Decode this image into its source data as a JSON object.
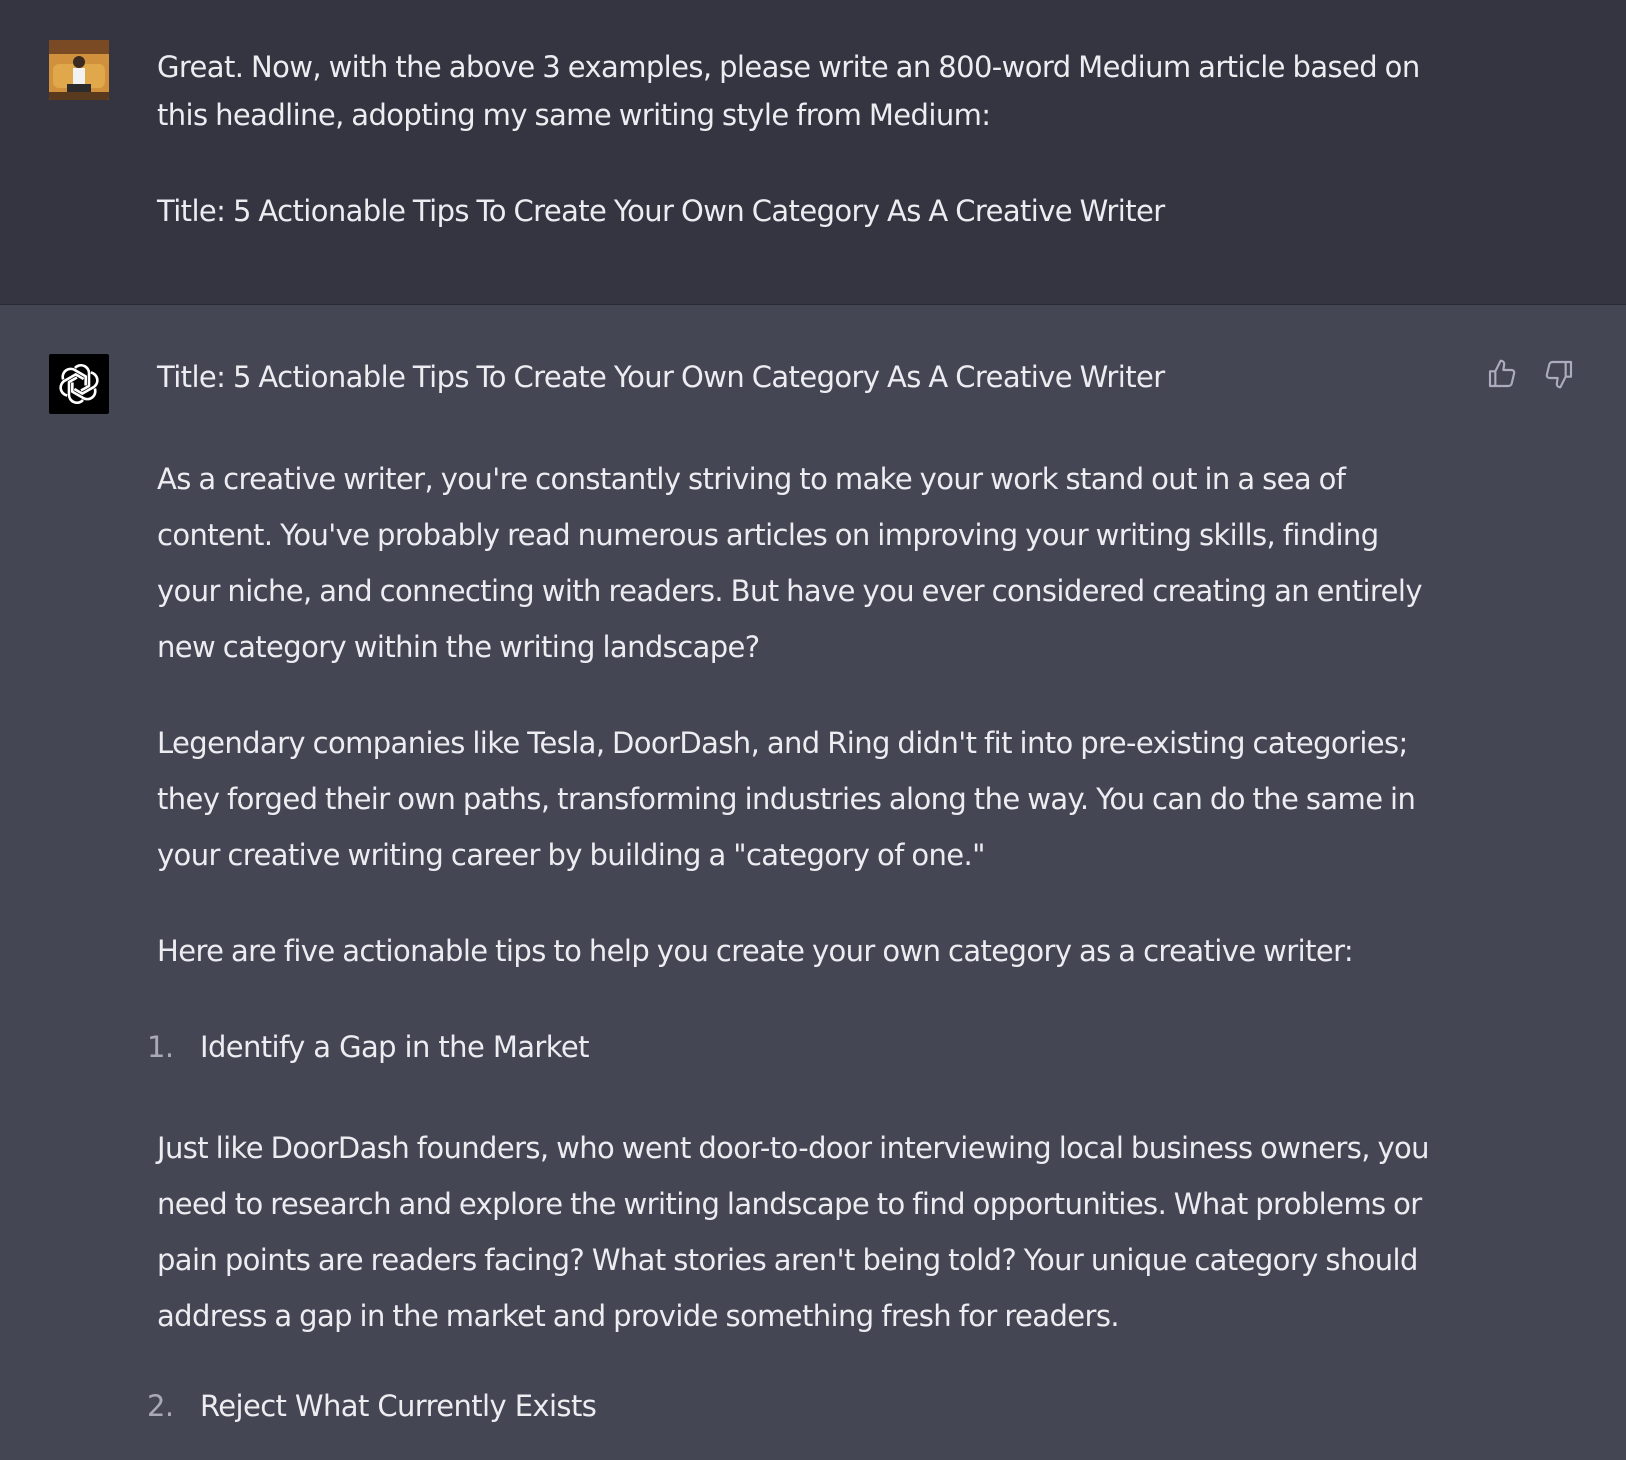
{
  "user_message": {
    "lines": [
      "Great. Now, with the above 3 examples, please write an 800-word Medium article based on",
      "this headline, adopting my same writing style from Medium:"
    ],
    "title": "Title: 5 Actionable Tips To Create Your Own Category As A Creative Writer"
  },
  "assistant_message": {
    "title": "Title: 5 Actionable Tips To Create Your Own Category As A Creative Writer",
    "paragraph1": [
      "As a creative writer, you're constantly striving to make your work stand out in a sea of",
      "content. You've probably read numerous articles on improving your writing skills, finding",
      "your niche, and connecting with readers. But have you ever considered creating an entirely",
      "new category within the writing landscape?"
    ],
    "paragraph2": [
      "Legendary companies like Tesla, DoorDash, and Ring didn't fit into pre-existing categories;",
      "they forged their own paths, transforming industries along the way. You can do the same in",
      "your creative writing career by building a \"category of one.\""
    ],
    "paragraph3": [
      "Here are five actionable tips to help you create your own category as a creative writer:"
    ],
    "list": [
      {
        "num": "1.",
        "label": "Identify a Gap in the Market"
      },
      {
        "num": "2.",
        "label": "Reject What Currently Exists"
      }
    ],
    "paragraph4": [
      "Just like DoorDash founders, who went door-to-door interviewing local business owners, you",
      "need to research and explore the writing landscape to find opportunities. What problems or",
      "pain points are readers facing? What stories aren't being told? Your unique category should",
      "address a gap in the market and provide something fresh for readers."
    ]
  },
  "icons": {
    "user_avatar": "user-avatar-photo",
    "bot_avatar": "openai-logo-icon",
    "thumbs_up": "thumbs-up-icon",
    "thumbs_down": "thumbs-down-icon"
  },
  "colors": {
    "user_bg": "#343541",
    "assistant_bg": "#444654",
    "text": "#ececf1",
    "muted": "#a9aab6"
  }
}
